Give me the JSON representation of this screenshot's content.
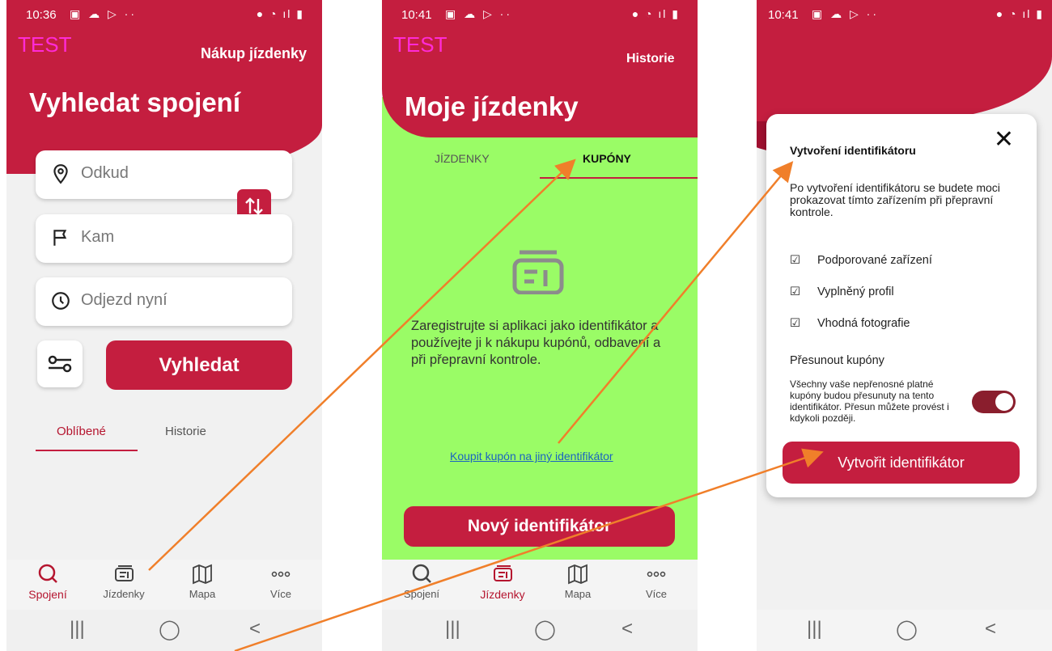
{
  "screen1": {
    "status_time": "10:36",
    "test_label": "TEST",
    "header_link": "Nákup jízdenky",
    "title": "Vyhledat spojení",
    "from_placeholder": "Odkud",
    "to_placeholder": "Kam",
    "time_value": "Odjezd nyní",
    "search_label": "Vyhledat",
    "tabs": [
      "Oblíbené",
      "Historie"
    ]
  },
  "screen2": {
    "status_time": "10:41",
    "test_label": "TEST",
    "header_link": "Historie",
    "title": "Moje jízdenky",
    "tabs": [
      "JÍZDENKY",
      "KUPÓNY"
    ],
    "empty_text": "Zaregistrujte si aplikaci jako identifikátor a používejte ji k nákupu kupónů, odbavení a při přepravní kontrole.",
    "link_text": "Koupit kupón na jiný identifikátor",
    "new_button": "Nový identifikátor"
  },
  "screen3": {
    "status_time": "10:41",
    "dialog_title": "Vytvoření identifikátoru",
    "dialog_text": "Po vytvoření identifikátoru se budete moci prokazovat tímto zařízením při přepravní kontrole.",
    "checks": [
      "Podporované zařízení",
      "Vyplněný profil",
      "Vhodná fotografie"
    ],
    "move_title": "Přesunout kupóny",
    "move_text": "Všechny vaše nepřenosné platné kupóny budou přesunuty na tento identifikátor. Přesun můžete provést i kdykoli později.",
    "create_button": "Vytvořit identifikátor",
    "close_symbol": "✕"
  },
  "nav": {
    "items": [
      "Spojení",
      "Jízdenky",
      "Mapa",
      "Více"
    ]
  },
  "colors": {
    "brand_red": "#c41e3f",
    "green_bg": "#9afc66",
    "arrow": "#f07f2a",
    "test_magenta": "#ff2bd6"
  },
  "icons": [
    "location-pin-icon",
    "flag-icon",
    "clock-icon",
    "swap-icon",
    "filter-icon",
    "search-icon",
    "ticket-icon",
    "map-icon",
    "more-icon",
    "checkbox-icon",
    "close-icon"
  ]
}
